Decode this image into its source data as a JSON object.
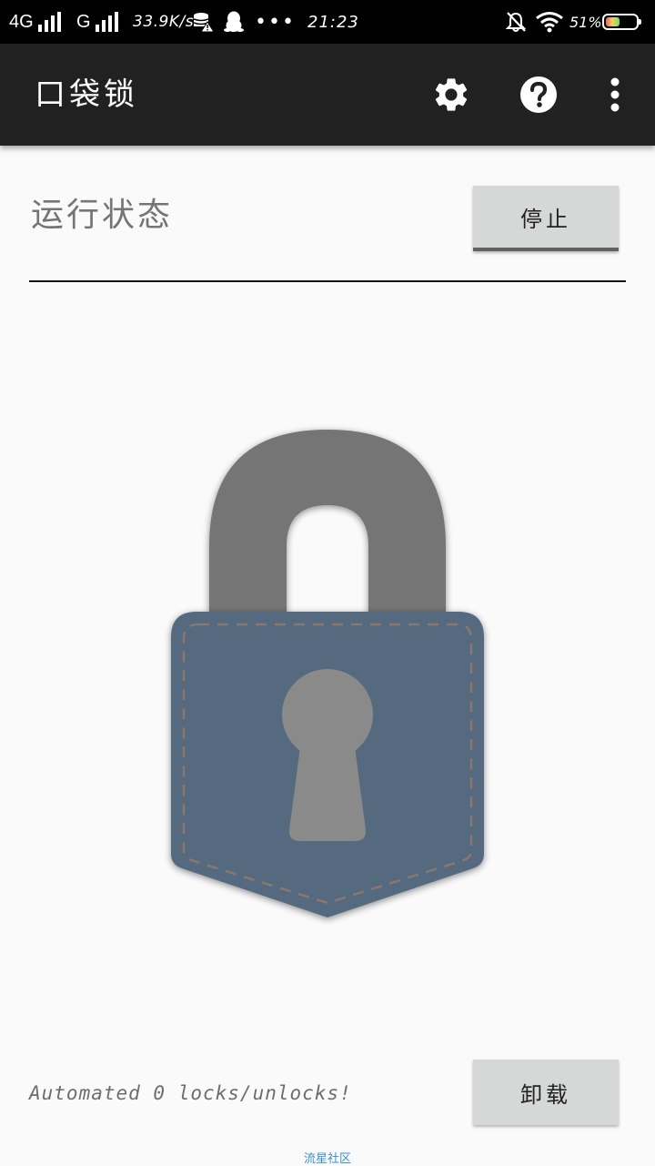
{
  "status_bar": {
    "network1": "4G",
    "network2": "G",
    "speed": "33.9K/s",
    "time": "21:23",
    "battery": "51%",
    "battery_level": 0.51
  },
  "app": {
    "title": "口袋锁",
    "settings_icon": "gear-icon",
    "help_icon": "help-circle-icon",
    "menu_icon": "more-vert-icon"
  },
  "main": {
    "status_label": "运行状态",
    "stop_button": "停止",
    "lock_image": "pocket-lock-icon",
    "colors": {
      "shackle": "#757575",
      "pocket": "#546a7e",
      "keyhole": "#8a8a8a",
      "stitch": "#8a7770"
    }
  },
  "footer": {
    "automation_text": "Automated 0 locks/unlocks!",
    "uninstall_button": "卸载",
    "watermark": "流星社区"
  }
}
